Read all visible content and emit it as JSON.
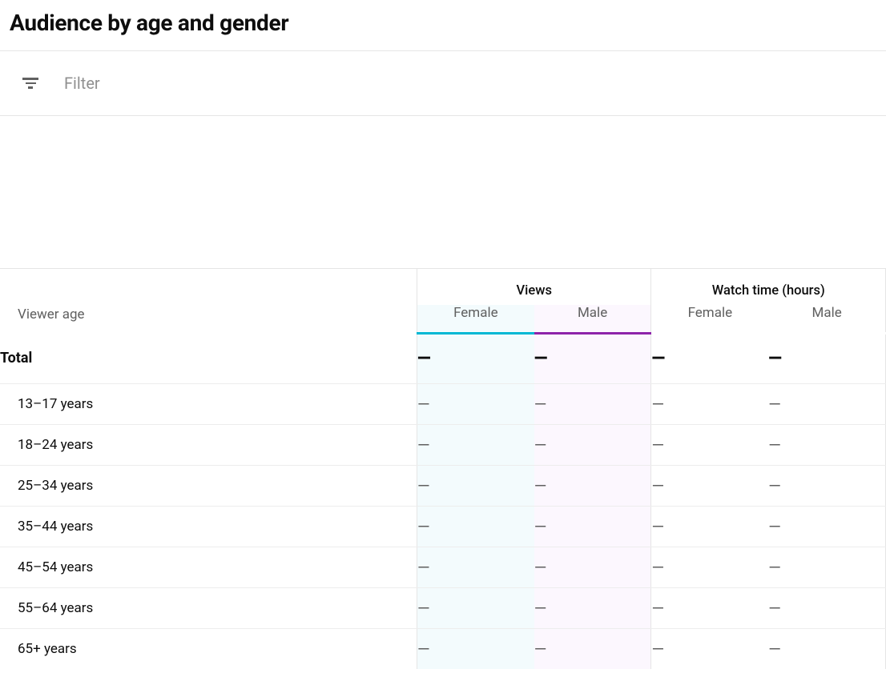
{
  "header": {
    "title": "Audience by age and gender"
  },
  "filter": {
    "placeholder": "Filter"
  },
  "table": {
    "columns": {
      "age_label": "Viewer age",
      "group_views": "Views",
      "group_watch": "Watch time (hours)",
      "female": "Female",
      "male": "Male"
    },
    "total": {
      "label": "Total",
      "views_female": "—",
      "views_male": "—",
      "watch_female": "—",
      "watch_male": "—"
    },
    "rows": [
      {
        "age": "13–17 years",
        "views_female": "—",
        "views_male": "—",
        "watch_female": "—",
        "watch_male": "—"
      },
      {
        "age": "18–24 years",
        "views_female": "—",
        "views_male": "—",
        "watch_female": "—",
        "watch_male": "—"
      },
      {
        "age": "25–34 years",
        "views_female": "—",
        "views_male": "—",
        "watch_female": "—",
        "watch_male": "—"
      },
      {
        "age": "35–44 years",
        "views_female": "—",
        "views_male": "—",
        "watch_female": "—",
        "watch_male": "—"
      },
      {
        "age": "45–54 years",
        "views_female": "—",
        "views_male": "—",
        "watch_female": "—",
        "watch_male": "—"
      },
      {
        "age": "55–64 years",
        "views_female": "—",
        "views_male": "—",
        "watch_female": "—",
        "watch_male": "—"
      },
      {
        "age": "65+ years",
        "views_female": "—",
        "views_male": "—",
        "watch_female": "—",
        "watch_male": "—"
      }
    ]
  },
  "colors": {
    "accent_female": "#00b8d4",
    "accent_male": "#8e24aa"
  }
}
